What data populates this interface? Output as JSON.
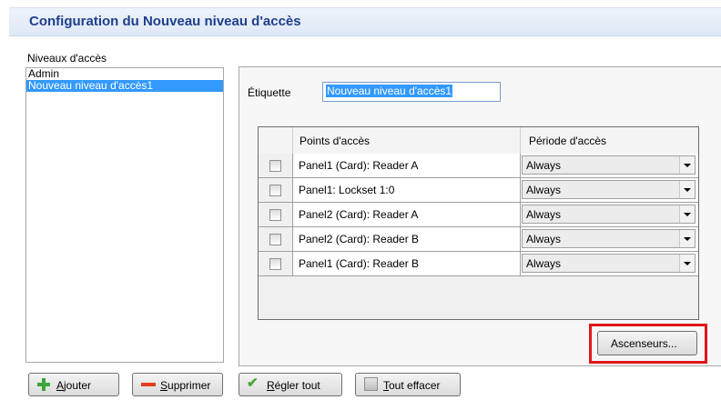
{
  "header": {
    "title": "Configuration du Nouveau niveau d'accès"
  },
  "levels": {
    "label": "Niveaux d'accès",
    "items": [
      "Admin",
      "Nouveau niveau d'accès1"
    ],
    "selected": "Nouveau niveau d'accès1"
  },
  "detail": {
    "etiquette_label": "Étiquette",
    "etiquette_value": "Nouveau niveau d'accès1"
  },
  "grid": {
    "col_points": "Points d'accès",
    "col_periode": "Période d'accès",
    "rows": [
      {
        "point": "Panel1 (Card): Reader A",
        "periode": "Always",
        "checked": false
      },
      {
        "point": "Panel1: Lockset 1:0",
        "periode": "Always",
        "checked": false
      },
      {
        "point": "Panel2 (Card): Reader A",
        "periode": "Always",
        "checked": false
      },
      {
        "point": "Panel2 (Card): Reader B",
        "periode": "Always",
        "checked": false
      },
      {
        "point": "Panel1 (Card): Reader B",
        "periode": "Always",
        "checked": false
      }
    ]
  },
  "buttons": {
    "ascenseurs": "Ascenseurs...",
    "ajouter_first": "A",
    "ajouter_rest": "jouter",
    "supprimer_first": "S",
    "supprimer_rest": "upprimer",
    "regler_first": "R",
    "regler_rest": "égler tout",
    "effacer_first": "T",
    "effacer_rest": "out effacer"
  },
  "colors": {
    "title": "#1f3f8c",
    "selection": "#3399ff",
    "highlight_border": "#e0161a"
  }
}
